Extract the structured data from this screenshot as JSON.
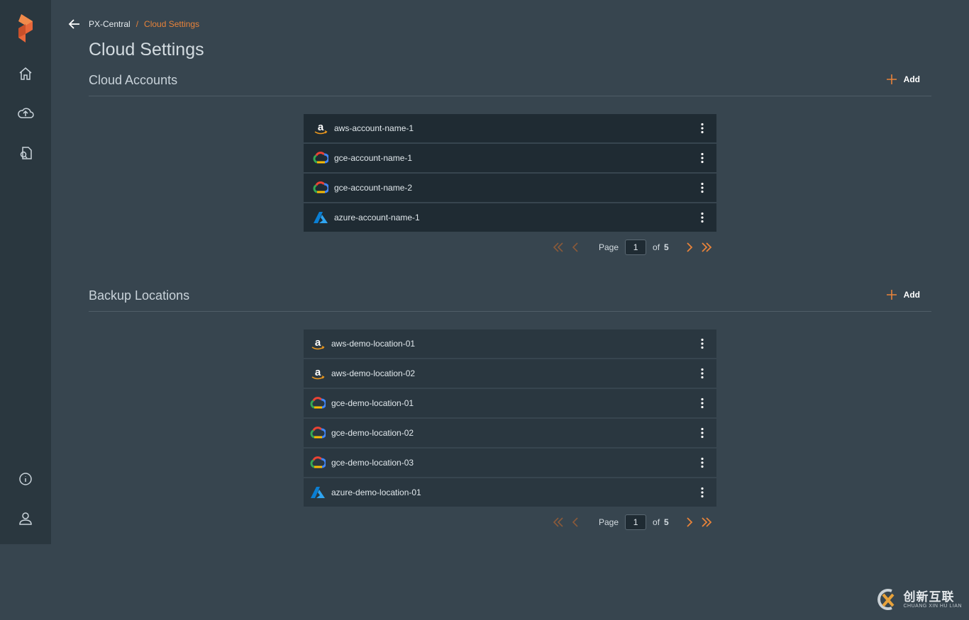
{
  "breadcrumb": {
    "root": "PX-Central",
    "separator": "/",
    "current": "Cloud Settings"
  },
  "page": {
    "title": "Cloud Settings"
  },
  "cloud_accounts": {
    "title": "Cloud Accounts",
    "add_label": "Add",
    "items": [
      {
        "provider": "aws",
        "name": "aws-account-name-1"
      },
      {
        "provider": "gce",
        "name": "gce-account-name-1"
      },
      {
        "provider": "gce",
        "name": "gce-account-name-2"
      },
      {
        "provider": "azure",
        "name": "azure-account-name-1"
      }
    ],
    "pager": {
      "page_label": "Page",
      "current": "1",
      "of_label": "of",
      "total": "5"
    }
  },
  "backup_locations": {
    "title": "Backup Locations",
    "add_label": "Add",
    "items": [
      {
        "provider": "aws",
        "name": "aws-demo-location-01"
      },
      {
        "provider": "aws",
        "name": "aws-demo-location-02"
      },
      {
        "provider": "gce",
        "name": "gce-demo-location-01"
      },
      {
        "provider": "gce",
        "name": "gce-demo-location-02"
      },
      {
        "provider": "gce",
        "name": "gce-demo-location-03"
      },
      {
        "provider": "azure",
        "name": "azure-demo-location-01"
      }
    ],
    "pager": {
      "page_label": "Page",
      "current": "1",
      "of_label": "of",
      "total": "5"
    }
  },
  "sidebar": {
    "icons": [
      "home-icon",
      "cloud-icon",
      "document-icon",
      "info-icon",
      "user-icon"
    ]
  },
  "watermark": {
    "cn": "创新互联",
    "en": "CHUANG XIN HU LIAN"
  },
  "colors": {
    "accent": "#e8833a",
    "background": "#37454f",
    "sidebar": "#2a373f",
    "row_dark": "#1f2b33",
    "row_mid": "#2a3740"
  }
}
